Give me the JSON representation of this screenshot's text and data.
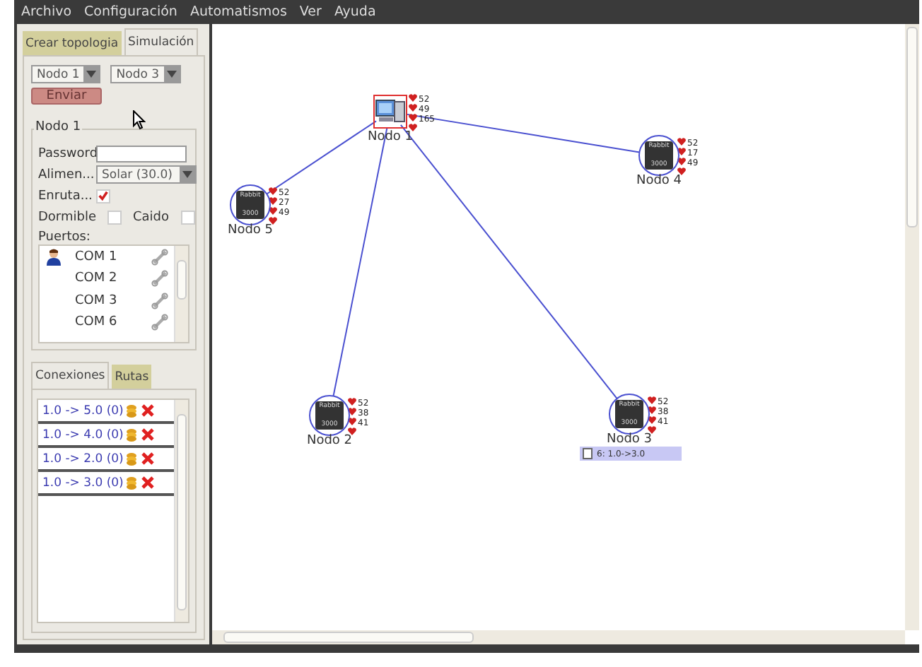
{
  "menu": [
    "Archivo",
    "Configuración",
    "Automatismos",
    "Ver",
    "Ayuda"
  ],
  "left_tabs": [
    {
      "label": "Crear topologia",
      "selected": false
    },
    {
      "label": "Simulación",
      "selected": true
    }
  ],
  "send": {
    "from": "Nodo 1",
    "to": "Nodo 3",
    "button": "Enviar"
  },
  "node_panel": {
    "title": "Nodo 1",
    "fields": [
      {
        "kind": "text",
        "label": "Password"
      },
      {
        "kind": "combo",
        "label": "Alimen...",
        "value": "Solar (30.0)"
      },
      {
        "kind": "check",
        "label": "Enruta...",
        "checked": true
      }
    ],
    "flags": [
      {
        "label": "Dormible",
        "checked": false
      },
      {
        "label": "Caido",
        "checked": false
      }
    ],
    "ports_label": "Puertos:",
    "ports": [
      {
        "name": "COM 1",
        "user": true
      },
      {
        "name": "COM 2",
        "user": false
      },
      {
        "name": "COM 3",
        "user": false
      },
      {
        "name": "COM 6",
        "user": false
      }
    ]
  },
  "bottom_tabs": [
    {
      "label": "Conexiones",
      "selected": true
    },
    {
      "label": "Rutas",
      "selected": false
    }
  ],
  "connections": [
    "1.0 -> 5.0 (0)",
    "1.0 -> 4.0 (0)",
    "1.0 -> 2.0 (0)",
    "1.0 -> 3.0 (0)"
  ],
  "nodes": [
    {
      "label": "Nodo 1",
      "kind": "pc",
      "selected": true,
      "stats": [
        "52",
        "49",
        "165"
      ]
    },
    {
      "label": "Nodo 4",
      "kind": "rabbit",
      "selected": false,
      "chip": [
        "Rabbit",
        "3000"
      ],
      "stats": [
        "52",
        "17",
        "49"
      ]
    },
    {
      "label": "Nodo 5",
      "kind": "rabbit",
      "selected": false,
      "chip": [
        "Rabbit",
        "3000"
      ],
      "stats": [
        "52",
        "27",
        "49"
      ]
    },
    {
      "label": "Nodo 2",
      "kind": "rabbit",
      "selected": false,
      "chip": [
        "Rabbit",
        "3000"
      ],
      "stats": [
        "52",
        "38",
        "41"
      ]
    },
    {
      "label": "Nodo 3",
      "kind": "rabbit",
      "selected": false,
      "chip": [
        "Rabbit",
        "3000"
      ],
      "stats": [
        "52",
        "38",
        "41"
      ],
      "tooltip": "6: 1.0->3.0"
    }
  ]
}
